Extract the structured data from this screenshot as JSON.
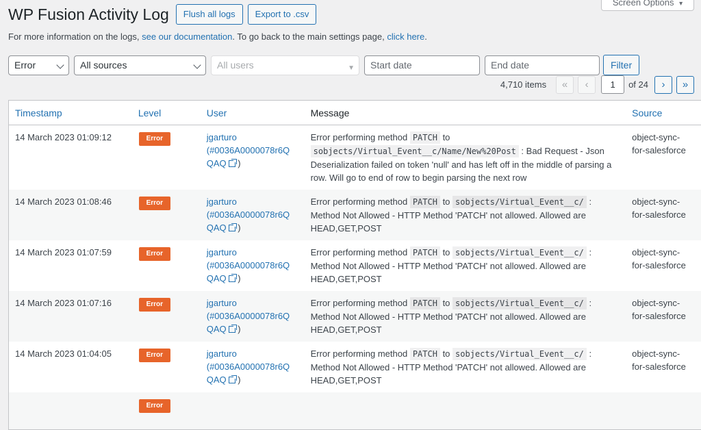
{
  "screen_options": "Screen Options",
  "header": {
    "title": "WP Fusion Activity Log",
    "flush_label": "Flush all logs",
    "export_label": "Export to .csv"
  },
  "intro": {
    "text1": "For more information on the logs, ",
    "link1": "see our documentation",
    "text2": ". To go back to the main settings page, ",
    "link2": "click here",
    "text3": "."
  },
  "filters": {
    "level": "Error",
    "source": "All sources",
    "users": "All users",
    "start_date": "Start date",
    "end_date": "End date",
    "filter_label": "Filter"
  },
  "pagination": {
    "items": "4,710 items",
    "first": "«",
    "prev": "‹",
    "current": "1",
    "of": "of 24",
    "next": "›",
    "last": "»"
  },
  "table": {
    "headers": {
      "timestamp": "Timestamp",
      "level": "Level",
      "user": "User",
      "message": "Message",
      "source": "Source"
    },
    "rows": [
      {
        "timestamp": "14 March 2023 01:09:12",
        "level": "Error",
        "user": "jgarturo",
        "user_id_a": "(#0036A0000078r6Q",
        "user_id_b": "QAQ",
        "user_close": ")",
        "msg_a": "Error performing method ",
        "method": "PATCH",
        "msg_b": " to ",
        "path": "sobjects/Virtual_Event__c/Name/New%20Post",
        "msg_c": " : Bad Request - Json Deserialization failed on token 'null' and has left off in the middle of parsing a row. Will go to end of row to begin parsing the next row",
        "source": "object-sync-for-salesforce"
      },
      {
        "timestamp": "14 March 2023 01:08:46",
        "level": "Error",
        "user": "jgarturo",
        "user_id_a": "(#0036A0000078r6Q",
        "user_id_b": "QAQ",
        "user_close": ")",
        "msg_a": "Error performing method ",
        "method": "PATCH",
        "msg_b": " to ",
        "path": "sobjects/Virtual_Event__c/",
        "msg_c": " : Method Not Allowed - HTTP Method 'PATCH' not allowed. Allowed are HEAD,GET,POST",
        "source": "object-sync-for-salesforce"
      },
      {
        "timestamp": "14 March 2023 01:07:59",
        "level": "Error",
        "user": "jgarturo",
        "user_id_a": "(#0036A0000078r6Q",
        "user_id_b": "QAQ",
        "user_close": ")",
        "msg_a": "Error performing method ",
        "method": "PATCH",
        "msg_b": " to ",
        "path": "sobjects/Virtual_Event__c/",
        "msg_c": " : Method Not Allowed - HTTP Method 'PATCH' not allowed. Allowed are HEAD,GET,POST",
        "source": "object-sync-for-salesforce"
      },
      {
        "timestamp": "14 March 2023 01:07:16",
        "level": "Error",
        "user": "jgarturo",
        "user_id_a": "(#0036A0000078r6Q",
        "user_id_b": "QAQ",
        "user_close": ")",
        "msg_a": "Error performing method ",
        "method": "PATCH",
        "msg_b": " to ",
        "path": "sobjects/Virtual_Event__c/",
        "msg_c": " : Method Not Allowed - HTTP Method 'PATCH' not allowed. Allowed are HEAD,GET,POST",
        "source": "object-sync-for-salesforce"
      },
      {
        "timestamp": "14 March 2023 01:04:05",
        "level": "Error",
        "user": "jgarturo",
        "user_id_a": "(#0036A0000078r6Q",
        "user_id_b": "QAQ",
        "user_close": ")",
        "msg_a": "Error performing method ",
        "method": "PATCH",
        "msg_b": " to ",
        "path": "sobjects/Virtual_Event__c/",
        "msg_c": " : Method Not Allowed - HTTP Method 'PATCH' not allowed. Allowed are HEAD,GET,POST",
        "source": "object-sync-for-salesforce"
      },
      {
        "timestamp": "",
        "level": "Error",
        "user": "",
        "user_id_a": "",
        "user_id_b": "",
        "user_close": "",
        "msg_a": "",
        "method": "",
        "msg_b": "",
        "path": "",
        "msg_c": "",
        "source": ""
      }
    ]
  },
  "colors": {
    "accent": "#2271b1",
    "error_badge": "#e7642a",
    "background": "#f0f0f1"
  },
  "icons": {
    "external_link": "external-link-icon"
  }
}
